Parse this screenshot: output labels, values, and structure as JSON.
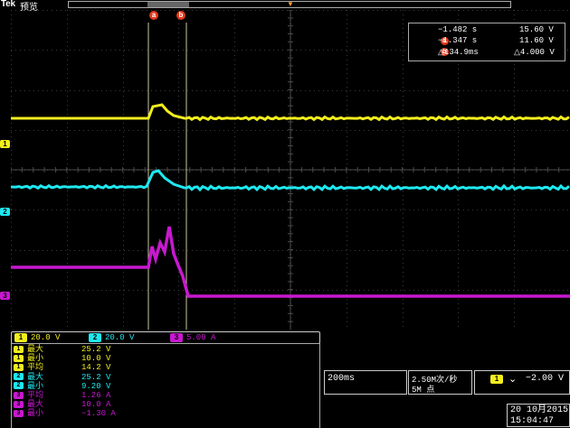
{
  "top": {
    "brand": "Tek",
    "status": "预览",
    "trigger_pos_icon": "trigger-position-marker"
  },
  "cursors": {
    "a": {
      "label": "a",
      "time": "−1.482 s",
      "value": "15.60 V"
    },
    "b": {
      "label": "b",
      "time": "−1.347 s",
      "value": "11.60 V"
    },
    "delta": {
      "time": "△134.9ms",
      "value": "△4.000 V"
    }
  },
  "channel_markers": [
    {
      "num": "1",
      "color": "#f2ee1e"
    },
    {
      "num": "2",
      "color": "#1ee8f0"
    },
    {
      "num": "3",
      "color": "#c818d0"
    }
  ],
  "scales": [
    {
      "num": "1",
      "value": "20.0 V"
    },
    {
      "num": "2",
      "value": "20.0 V"
    },
    {
      "num": "3",
      "value": "5.00 A"
    }
  ],
  "measurements": [
    {
      "ch": "1",
      "label": "最大",
      "value": "25.2 V"
    },
    {
      "ch": "1",
      "label": "最小",
      "value": "10.0 V"
    },
    {
      "ch": "1",
      "label": "平均",
      "value": "14.2 V"
    },
    {
      "ch": "2",
      "label": "最大",
      "value": "25.2 V"
    },
    {
      "ch": "2",
      "label": "最小",
      "value": "9.20 V"
    },
    {
      "ch": "3",
      "label": "平均",
      "value": "1.26 A"
    },
    {
      "ch": "3",
      "label": "最大",
      "value": "10.0 A"
    },
    {
      "ch": "3",
      "label": "最小",
      "value": "−1.30 A"
    }
  ],
  "timebase": {
    "value": "200ms"
  },
  "acquisition": {
    "rate": "2.50M次/秒",
    "points": "5M 点"
  },
  "trigger": {
    "ch": "1",
    "slope_icon": "falling-edge-icon",
    "slope": "⌄",
    "level": "−2.00 V"
  },
  "datetime": {
    "date": "20 10月2015",
    "time": "15:04:47"
  },
  "colors": {
    "ch1": "#f2ee1e",
    "ch2": "#1ee8f0",
    "ch3": "#c818d0",
    "cursor": "#e0391c"
  }
}
